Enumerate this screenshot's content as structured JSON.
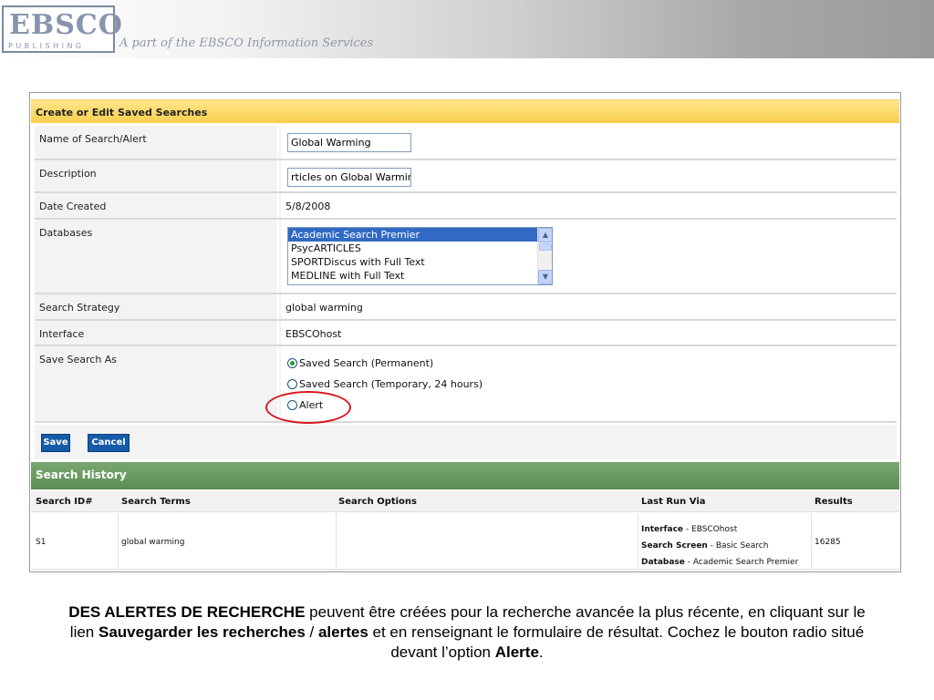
{
  "header": {
    "logo_main": "EBSCO",
    "logo_sub": "PUBLISHING",
    "tagline": "A part of the EBSCO Information Services"
  },
  "form": {
    "title": "Create or Edit Saved Searches",
    "name_label": "Name of Search/Alert",
    "name_value": "Global Warming",
    "description_label": "Description",
    "description_value": "rticles on Global Warming",
    "date_label": "Date Created",
    "date_value": "5/8/2008",
    "databases_label": "Databases",
    "databases": [
      "Academic Search Premier",
      "PsycARTICLES",
      "SPORTDiscus with Full Text",
      "MEDLINE with Full Text"
    ],
    "strategy_label": "Search Strategy",
    "strategy_value": "global warming",
    "interface_label": "Interface",
    "interface_value": "EBSCOhost",
    "save_as_label": "Save Search As",
    "save_options": [
      "Saved Search (Permanent)",
      "Saved Search (Temporary, 24 hours)",
      "Alert"
    ],
    "selected_option": "Saved Search (Permanent)",
    "save_button": "Save",
    "cancel_button": "Cancel"
  },
  "history": {
    "title": "Search History",
    "columns": [
      "Search ID#",
      "Search Terms",
      "Search Options",
      "Last Run Via",
      "Results"
    ],
    "rows": [
      {
        "id": "S1",
        "terms": "global warming",
        "options": "",
        "interface_label": "Interface",
        "interface_value": "- EBSCOhost",
        "screen_label": "Search Screen",
        "screen_value": "- Basic Search",
        "database_label": "Database",
        "database_value": "- Academic Search Premier",
        "results": "16285"
      }
    ]
  },
  "caption": {
    "b1": "DES ALERTES DE RECHERCHE",
    "t1": " peuvent être créées pour la recherche avancée la plus récente, en cliquant sur le lien ",
    "b2": "Sauvegarder les recherches",
    "t2": " / ",
    "b3": "alertes",
    "t3": " et en renseignant le formulaire de résultat. Cochez le bouton radio situé devant l’option ",
    "b4": "Alerte",
    "t4": "."
  },
  "colors": {
    "form_header": "#f9cf4f",
    "history_header": "#5a8e52",
    "button": "#155ba8",
    "highlight": "#d9161c",
    "selected_option": "#316ac5"
  }
}
